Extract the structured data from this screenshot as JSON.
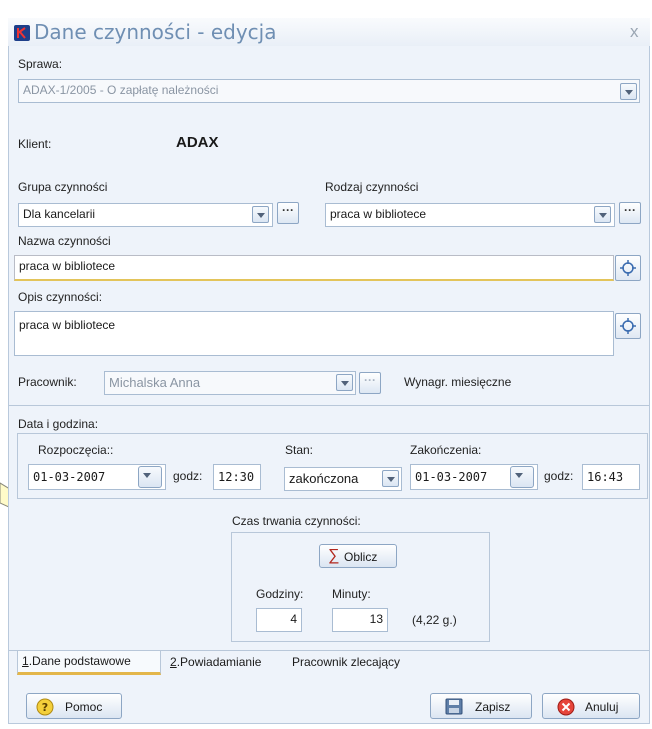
{
  "window": {
    "title": "Dane czynności - edycja",
    "close_glyph": "x"
  },
  "sprawa": {
    "label": "Sprawa:",
    "value": "ADAX-1/2005 - O zapłatę należności"
  },
  "klient": {
    "label": "Klient:",
    "value": "ADAX"
  },
  "grupa": {
    "label": "Grupa czynności",
    "value": "Dla kancelarii"
  },
  "rodzaj": {
    "label": "Rodzaj czynności",
    "value": "praca w bibliotece"
  },
  "nazwa": {
    "label": "Nazwa czynności",
    "value": "praca w bibliotece"
  },
  "opis": {
    "label": "Opis czynności:",
    "value": "praca w bibliotece"
  },
  "pracownik": {
    "label": "Pracownik:",
    "value": "Michalska Anna",
    "wynagr": "Wynagr. miesięczne"
  },
  "datetime": {
    "label": "Data i godzina:",
    "rozpoczecia_label": "Rozpoczęcia::",
    "start_date": "01-03-2007",
    "godz_label": "godz:",
    "start_time": "12:30",
    "stan_label": "Stan:",
    "stan_value": "zakończona",
    "zakonczenia_label": "Zakończenia:",
    "end_date": "01-03-2007",
    "end_time": "16:43"
  },
  "duration": {
    "label": "Czas trwania czynności:",
    "oblicz_label": "Oblicz",
    "godziny_label": "Godziny:",
    "minuty_label": "Minuty:",
    "hours": "4",
    "minutes": "13",
    "total": "(4,22 g.)"
  },
  "tabs": [
    {
      "key": "1",
      "label": ".Dane podstawowe"
    },
    {
      "key": "2",
      "label": ".Powiadamianie"
    },
    {
      "key": "",
      "label": "Pracownik zlecający"
    }
  ],
  "buttons": {
    "pomoc": "Pomoc",
    "zapisz": "Zapisz",
    "anuluj": "Anuluj"
  },
  "colors": {
    "accent": "#6f8fb3",
    "border": "#a9bcd2",
    "window_bg": "#eef3fa",
    "active_underline": "#e3c45a"
  }
}
